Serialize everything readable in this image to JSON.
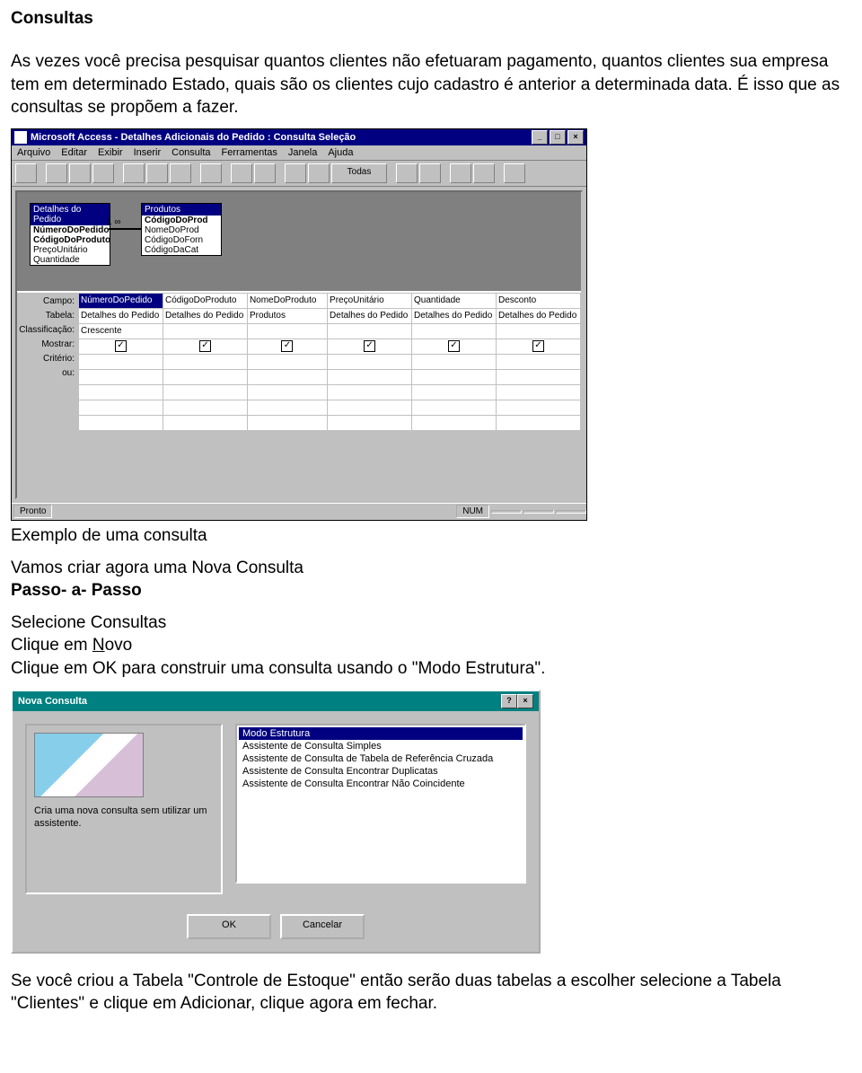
{
  "doc": {
    "title": "Consultas",
    "intro": "As vezes você precisa pesquisar quantos clientes não efetuaram pagamento, quantos clientes sua empresa tem em determinado Estado, quais são os clientes cujo cadastro é anterior a determinada data. É isso que as consultas se propõem a fazer.",
    "caption1": "Exemplo de uma consulta",
    "step_intro": "Vamos criar agora uma Nova Consulta",
    "step_label": "Passo- a- Passo",
    "step_a": "Selecione Consultas",
    "step_b_prefix": "Clique em ",
    "step_b_u": "N",
    "step_b_rest": "ovo",
    "step_c": "Clique em OK para construir uma consulta usando o \"Modo Estrutura\".",
    "closing": "Se você criou a Tabela \"Controle de Estoque\" então serão duas tabelas a escolher selecione a Tabela \"Clientes\" e clique em Adicionar, clique agora em fechar."
  },
  "access": {
    "app_title": "Microsoft Access - Detalhes Adicionais do Pedido : Consulta Seleção",
    "menu": [
      "Arquivo",
      "Editar",
      "Exibir",
      "Inserir",
      "Consulta",
      "Ferramentas",
      "Janela",
      "Ajuda"
    ],
    "tool_label": "Todas",
    "tables": {
      "left": {
        "title": "Detalhes do Pedido",
        "fields": [
          "NúmeroDoPedido",
          "CódigoDoProduto",
          "PreçoUnitário",
          "Quantidade"
        ]
      },
      "right": {
        "title": "Produtos",
        "fields": [
          "CódigoDoProd",
          "NomeDoProd",
          "CódigoDoForn",
          "CódigoDaCat"
        ]
      },
      "link": "1       ∞"
    },
    "row_labels": [
      "Campo:",
      "Tabela:",
      "Classificação:",
      "Mostrar:",
      "Critério:",
      "ou:"
    ],
    "columns": [
      {
        "campo": "NúmeroDoPedido",
        "tabela": "Detalhes do Pedido",
        "class": "Crescente",
        "mostrar": true
      },
      {
        "campo": "CódigoDoProduto",
        "tabela": "Detalhes do Pedido",
        "class": "",
        "mostrar": true
      },
      {
        "campo": "NomeDoProduto",
        "tabela": "Produtos",
        "class": "",
        "mostrar": true
      },
      {
        "campo": "PreçoUnitário",
        "tabela": "Detalhes do Pedido",
        "class": "",
        "mostrar": true
      },
      {
        "campo": "Quantidade",
        "tabela": "Detalhes do Pedido",
        "class": "",
        "mostrar": true
      },
      {
        "campo": "Desconto",
        "tabela": "Detalhes do Pedido",
        "class": "",
        "mostrar": true
      }
    ],
    "status_left": "Pronto",
    "status_right": "NUM"
  },
  "dialog": {
    "title": "Nova Consulta",
    "description": "Cria uma nova consulta sem utilizar um assistente.",
    "options": [
      "Modo Estrutura",
      "Assistente de Consulta Simples",
      "Assistente de Consulta de Tabela de Referência Cruzada",
      "Assistente de Consulta Encontrar Duplicatas",
      "Assistente de Consulta Encontrar Não Coincidente"
    ],
    "selected_index": 0,
    "ok": "OK",
    "cancel": "Cancelar",
    "help": "?",
    "close": "×"
  }
}
